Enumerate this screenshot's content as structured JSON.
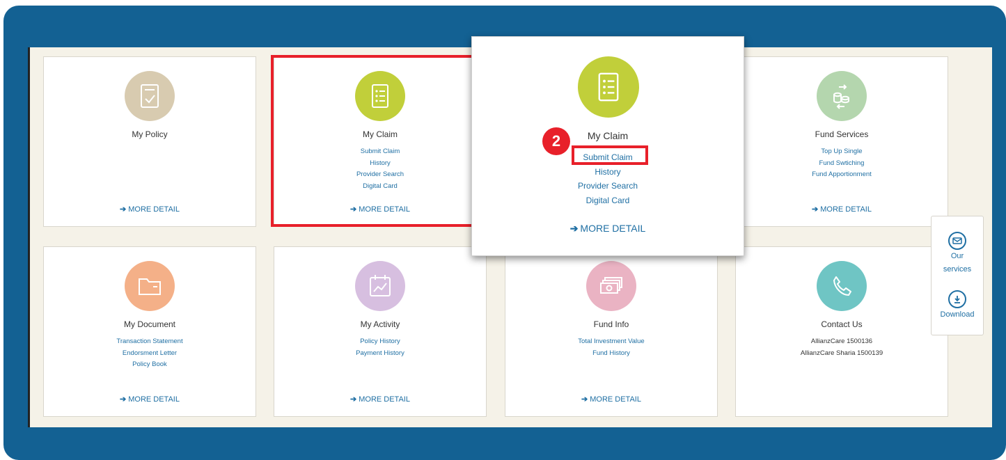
{
  "cards": [
    {
      "title": "My Policy",
      "lines": [],
      "more": "MORE DETAIL",
      "color": "#d8cbb0",
      "icon": "policy-document-icon"
    },
    {
      "title": "My Claim",
      "lines": [
        "Submit Claim",
        "History",
        "Provider Search",
        "Digital Card"
      ],
      "more": "MORE DETAIL",
      "color": "#c1cf3a",
      "icon": "claim-list-icon"
    },
    {
      "title": "Fund Services",
      "lines": [
        "Top Up Single",
        "Fund Swtiching",
        "Fund Apportionment"
      ],
      "more": "MORE DETAIL",
      "color": "#b4d6ae",
      "icon": "fund-coins-icon"
    },
    {
      "title": "My Document",
      "lines": [
        "Transaction Statement",
        "Endorsment Letter",
        "Policy Book"
      ],
      "more": "MORE DETAIL",
      "color": "#f4b088",
      "icon": "folder-icon"
    },
    {
      "title": "My Activity",
      "lines": [
        "Policy History",
        "Payment History"
      ],
      "more": "MORE DETAIL",
      "color": "#d7bfe0",
      "icon": "activity-chart-icon"
    },
    {
      "title": "Fund Info",
      "lines": [
        "Total Investment Value",
        "Fund History"
      ],
      "more": "MORE DETAIL",
      "color": "#eab3c3",
      "icon": "money-icon"
    },
    {
      "title": "Contact Us",
      "lines": [
        "AllianzCare 1500136",
        "AllianzCare Sharia 1500139"
      ],
      "more": "MORE DETAIL",
      "color": "#6fc5c4",
      "icon": "phone-icon"
    }
  ],
  "popup": {
    "title": "My Claim",
    "lines": [
      "Submit Claim",
      "History",
      "Provider Search",
      "Digital Card"
    ],
    "more": "MORE DETAIL",
    "step": "2"
  },
  "sidebar": {
    "services_line1": "Our",
    "services_line2": "services",
    "download": "Download"
  },
  "colors": {
    "frame": "#136193",
    "highlight": "#e8202a",
    "link": "#1f6fa3"
  }
}
